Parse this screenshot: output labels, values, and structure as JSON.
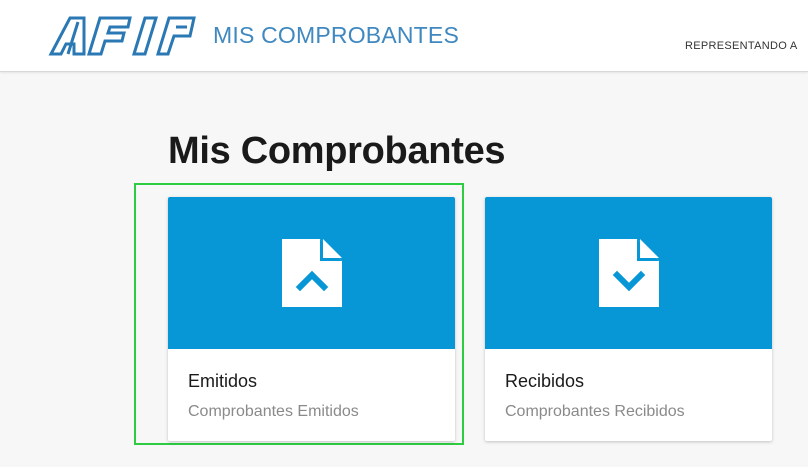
{
  "header": {
    "logo_text": "AFIP",
    "app_title": "MIS COMPROBANTES",
    "representando": "REPRESENTANDO A"
  },
  "main": {
    "page_title": "Mis Comprobantes",
    "cards": [
      {
        "title": "Emitidos",
        "subtitle": "Comprobantes Emitidos",
        "icon": "document-upload-icon"
      },
      {
        "title": "Recibidos",
        "subtitle": "Comprobantes Recibidos",
        "icon": "document-download-icon"
      }
    ]
  },
  "colors": {
    "brand_blue": "#3f88c0",
    "card_blue": "#0796d6",
    "focus_green": "#2ecc40"
  }
}
